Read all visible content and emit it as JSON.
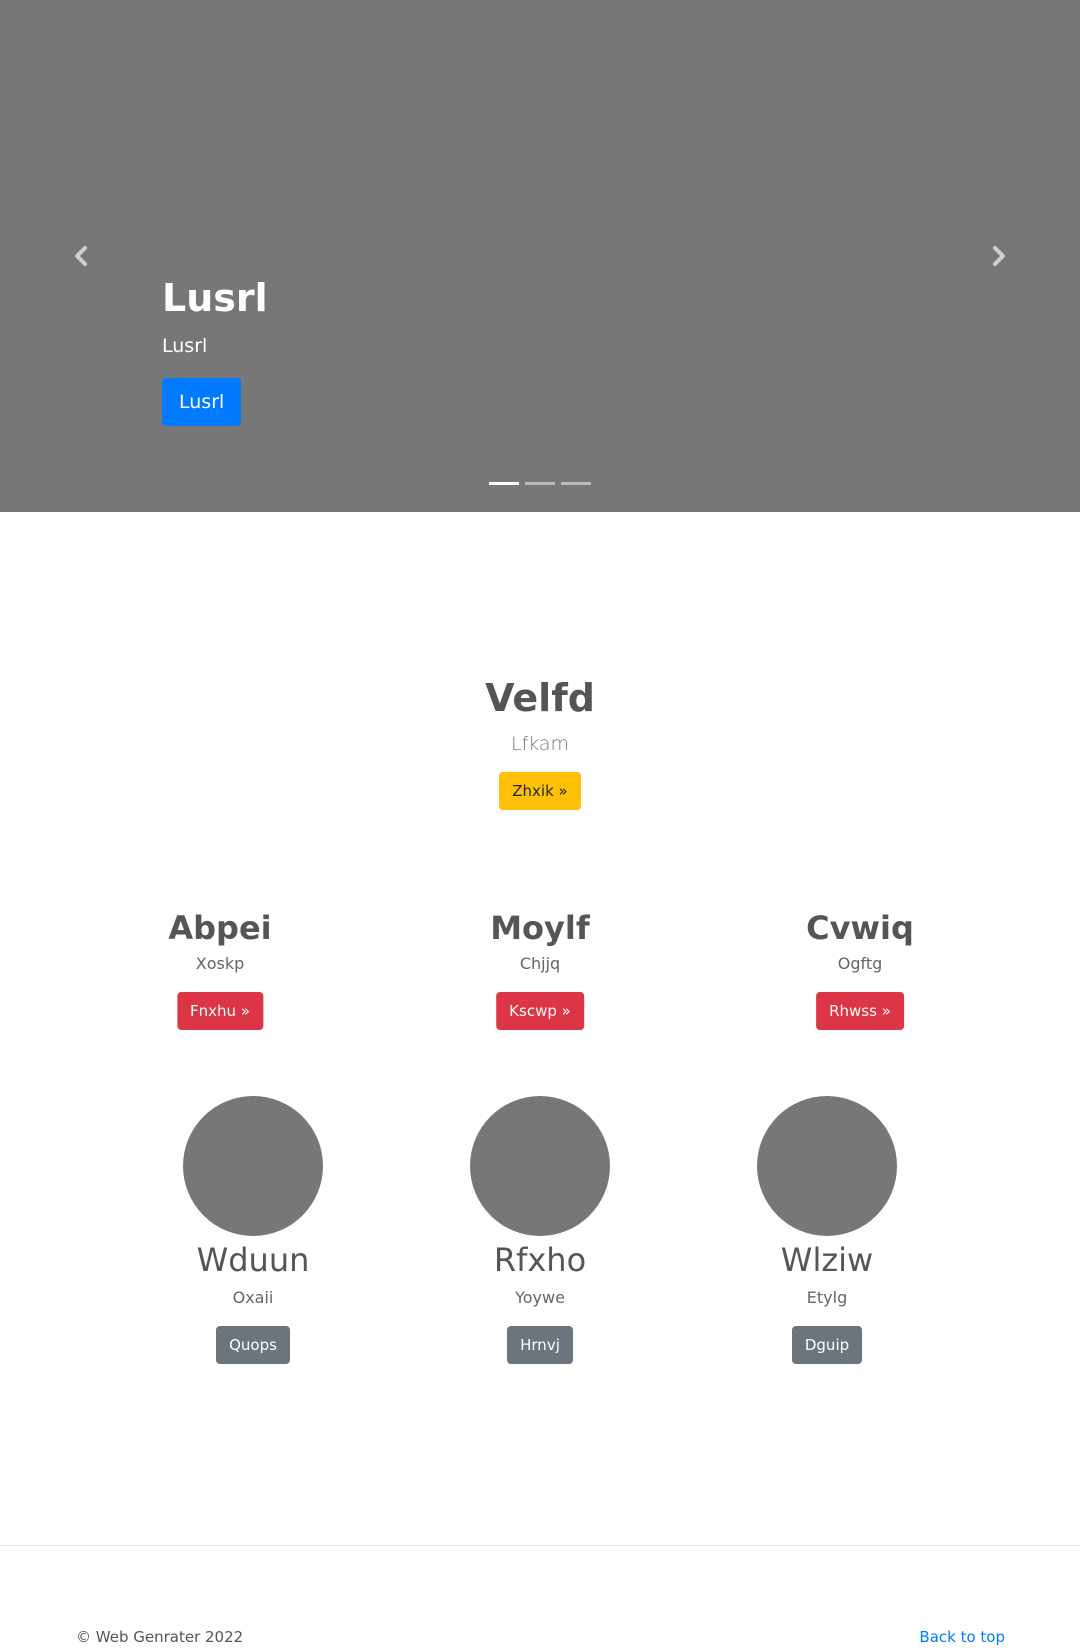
{
  "carousel": {
    "title": "Lusrl",
    "text": "Lusrl",
    "button_label": "Lusrl",
    "prev_icon": "chevron-left-icon",
    "next_icon": "chevron-right-icon",
    "slide_count": 3,
    "active_slide": 1
  },
  "hero": {
    "title": "Velfd",
    "subtitle": "Lfkam",
    "button_label": "Zhxik »"
  },
  "features": [
    {
      "title": "Abpei",
      "subtitle": "Xoskp",
      "button_label": "Fnxhu »"
    },
    {
      "title": "Moylf",
      "subtitle": "Chjjq",
      "button_label": "Kscwp »"
    },
    {
      "title": "Cvwiq",
      "subtitle": "Ogftg",
      "button_label": "Rhwss »"
    }
  ],
  "people": [
    {
      "name": "Wduun",
      "subtitle": "Oxaii",
      "button_label": "Quops"
    },
    {
      "name": "Rfxho",
      "subtitle": "Yoywe",
      "button_label": "Hrnvj"
    },
    {
      "name": "Wlziw",
      "subtitle": "Etylg",
      "button_label": "Dguip"
    }
  ],
  "footer": {
    "copyright": "© Web Genrater 2022",
    "back_to_top": "Back to top"
  },
  "colors": {
    "carousel_bg": "#777777",
    "primary": "#007bff",
    "warning": "#ffc107",
    "danger": "#dc3545",
    "secondary": "#6c757d"
  }
}
